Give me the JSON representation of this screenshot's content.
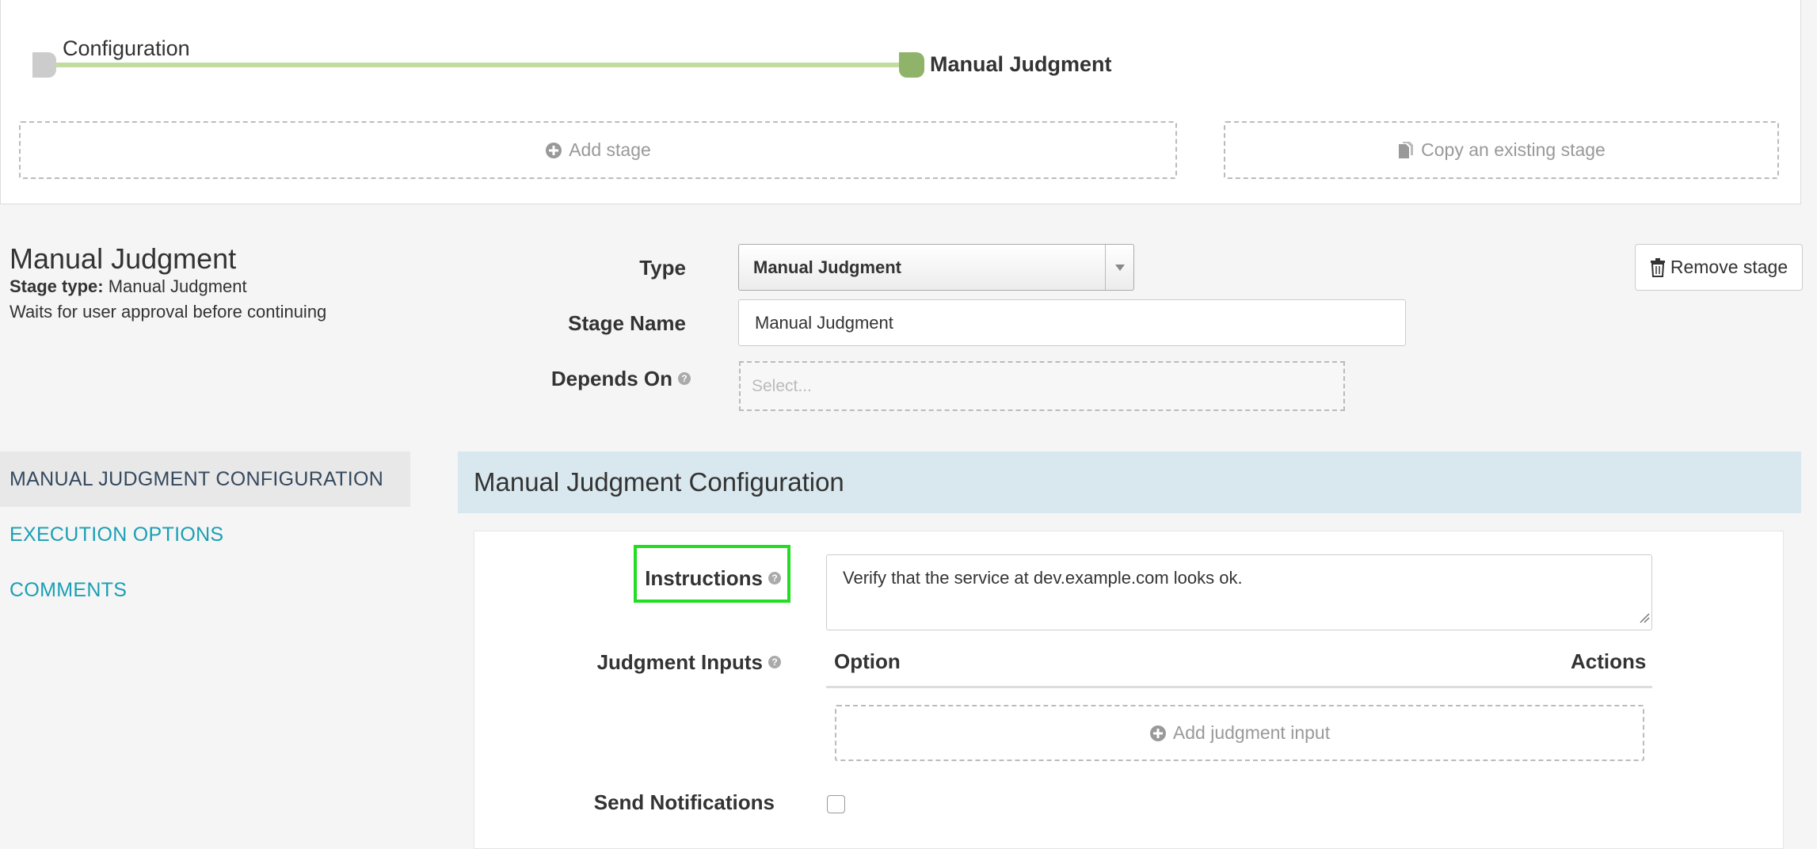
{
  "pipeline": {
    "nodes": [
      {
        "label": "Configuration"
      },
      {
        "label": "Manual Judgment"
      }
    ],
    "add_stage_label": "Add stage",
    "copy_stage_label": "Copy an existing stage"
  },
  "stage": {
    "title": "Manual Judgment",
    "type_prefix": "Stage type:",
    "type_value": "Manual Judgment",
    "description": "Waits for user approval before continuing"
  },
  "form": {
    "type_label": "Type",
    "type_value": "Manual Judgment",
    "stage_name_label": "Stage Name",
    "stage_name_value": "Manual Judgment",
    "depends_on_label": "Depends On",
    "depends_on_placeholder": "Select...",
    "remove_label": "Remove stage"
  },
  "nav": {
    "items": [
      {
        "label": "MANUAL JUDGMENT CONFIGURATION",
        "active": true
      },
      {
        "label": "EXECUTION OPTIONS",
        "active": false
      },
      {
        "label": "COMMENTS",
        "active": false
      }
    ]
  },
  "config": {
    "section_title": "Manual Judgment Configuration",
    "instructions_label": "Instructions",
    "instructions_value": "Verify that the service at dev.example.com looks ok.",
    "judgment_inputs_label": "Judgment Inputs",
    "option_header": "Option",
    "actions_header": "Actions",
    "add_judgment_input_label": "Add judgment input",
    "send_notifications_label": "Send Notifications",
    "send_notifications_checked": false
  },
  "colors": {
    "pipeline_line": "#c2dca0",
    "node_active": "#8fb368",
    "node_inactive": "#cccccc",
    "nav_link": "#1a9fb4",
    "section_header_bg": "#d9e8ee",
    "highlight": "#22dd22"
  }
}
